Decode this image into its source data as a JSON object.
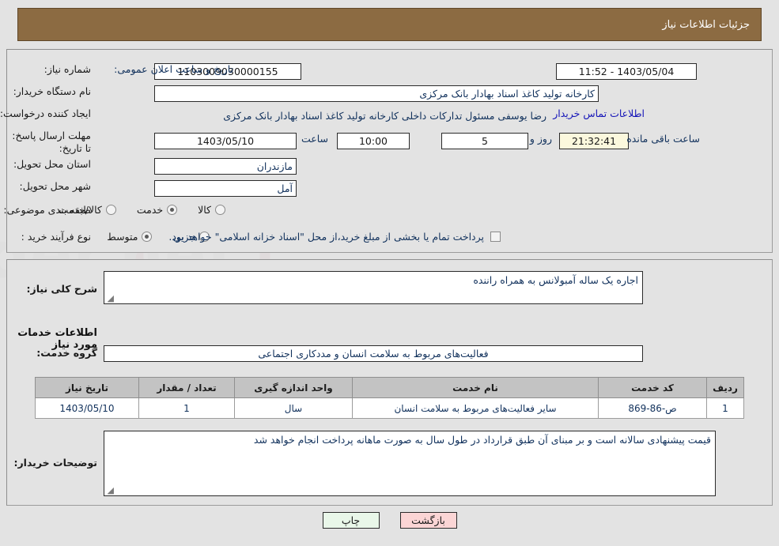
{
  "header": {
    "title": "جزئیات اطلاعات نیاز"
  },
  "top_form": {
    "need_number": {
      "label": "شماره نیاز:",
      "value": "1103009030000155"
    },
    "announce_datetime": {
      "label": "تاریخ و ساعت اعلان عمومی:",
      "value": "1403/05/04 - 11:52"
    },
    "buyer_org": {
      "label": "نام دستگاه خریدار:",
      "value": "کارخانه تولید کاغذ اسناد بهادار بانک مرکزی"
    },
    "requester": {
      "label": "ایجاد کننده درخواست:",
      "value": "رضا یوسفی مسئول تدارکات داخلی کارخانه تولید کاغذ اسناد بهادار بانک مرکزی",
      "contact_link": "اطلاعات تماس خریدار"
    },
    "deadline": {
      "label": "مهلت ارسال پاسخ: تا تاریخ:",
      "date": "1403/05/10",
      "hour_label": "ساعت",
      "hour": "10:00",
      "days": "5",
      "days_unit": "روز و",
      "countdown": "21:32:41",
      "countdown_unit": "ساعت باقی مانده"
    },
    "province": {
      "label": "استان محل تحویل:",
      "value": "مازندران"
    },
    "city": {
      "label": "شهر محل تحویل:",
      "value": "آمل"
    },
    "category": {
      "label": "طبقه بندی موضوعی:",
      "options": [
        {
          "label": "کالا",
          "selected": false
        },
        {
          "label": "خدمت",
          "selected": true
        },
        {
          "label": "کالا/خدمت",
          "selected": false
        }
      ]
    },
    "purchase_type": {
      "label": "نوع فرآیند خرید :",
      "options": [
        {
          "label": "جزیی",
          "selected": false
        },
        {
          "label": "متوسط",
          "selected": true
        }
      ]
    },
    "treasury_note": {
      "checked": false,
      "text": "پرداخت تمام یا بخشی از مبلغ خرید،از محل \"اسناد خزانه اسلامی\" خواهد بود."
    }
  },
  "bottom": {
    "need_summary": {
      "label": "شرح کلی نیاز:",
      "value": "اجاره یک ساله آمبولانس به همراه راننده"
    },
    "services_section_title": "اطلاعات خدمات مورد نیاز",
    "service_group": {
      "label": "گروه خدمت:",
      "value": "فعالیت‌های مربوط به سلامت انسان و مددکاری اجتماعی"
    },
    "table": {
      "headers": [
        "ردیف",
        "کد خدمت",
        "نام خدمت",
        "واحد اندازه گیری",
        "تعداد / مقدار",
        "تاریخ نیاز"
      ],
      "rows": [
        {
          "row_no": "1",
          "service_code": "ص-86-869",
          "service_name": "سایر فعالیت‌های مربوط به سلامت انسان",
          "unit": "سال",
          "quantity": "1",
          "need_date": "1403/05/10"
        }
      ]
    },
    "buyer_comments": {
      "label": "توضیحات خریدار:",
      "value": "قیمت پیشنهادی سالانه است و بر مبنای آن طبق قرارداد در طول سال به صورت ماهانه پرداخت انجام خواهد شد"
    }
  },
  "buttons": {
    "print": "چاپ",
    "back": "بازگشت"
  },
  "colors": {
    "header_bg": "#8c6b42",
    "page_bg": "#e3e3e3",
    "link": "#1414b8",
    "table_header_bg": "#c3c3c3",
    "print_btn_bg": "#e9f7e9",
    "back_btn_bg": "#fbd5d5"
  }
}
